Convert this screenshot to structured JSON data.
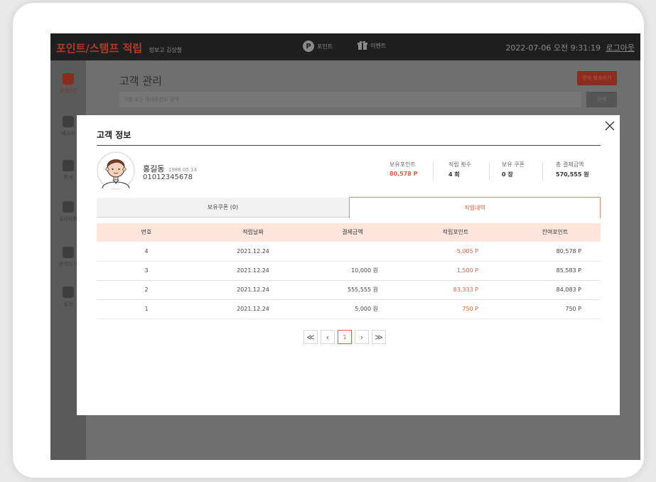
{
  "header": {
    "brand": "포인트/스탬프 적립",
    "brand_sub": "정보고 김상철",
    "nav_points_icon": "P",
    "nav_points": "포인트",
    "nav_event": "이벤트",
    "datetime": "2022-07-06 오전 9:31:19",
    "logout": "로그아웃"
  },
  "sidebar": {
    "items": [
      {
        "label": "고객관리"
      },
      {
        "label": "메시지"
      },
      {
        "label": "통계"
      },
      {
        "label": "공지사항"
      },
      {
        "label": "문의하기"
      },
      {
        "label": "설정"
      }
    ]
  },
  "page": {
    "title": "고객 관리",
    "send_button": "문자 발송하기",
    "search_placeholder": "이름 또는 휴대폰번호 검색",
    "search_button": "검색"
  },
  "modal": {
    "title": "고객 정보",
    "customer": {
      "name": "홍길동",
      "birth": "1988.05.14",
      "phone": "01012345678"
    },
    "stats": [
      {
        "label": "보유포인트",
        "value": "80,578 P",
        "color": "#e55a3f"
      },
      {
        "label": "적립 횟수",
        "value": "4 회"
      },
      {
        "label": "보유 쿠폰",
        "value": "0 장"
      },
      {
        "label": "총 결제금액",
        "value": "570,555 원"
      }
    ],
    "tabs": {
      "coupons": "보유쿠폰 (0)",
      "history": "적립내역"
    },
    "table": {
      "headers": [
        "번호",
        "적립날짜",
        "결제금액",
        "적립포인트",
        "잔여포인트"
      ],
      "rows": [
        [
          "4",
          "2021.12.24",
          "",
          "-5,005 P",
          "80,578 P"
        ],
        [
          "3",
          "2021.12.24",
          "10,000 원",
          "1,500 P",
          "85,583 P"
        ],
        [
          "2",
          "2021.12.24",
          "555,555 원",
          "83,333 P",
          "84,083 P"
        ],
        [
          "1",
          "2021.12.24",
          "5,000 원",
          "750 P",
          "750 P"
        ]
      ]
    },
    "pagination": {
      "first": "≪",
      "prev": "‹",
      "current": "1",
      "next": "›",
      "last": "≫"
    }
  },
  "colors": {
    "accent": "#e55a3f",
    "header_bg": "#fde5dc"
  }
}
